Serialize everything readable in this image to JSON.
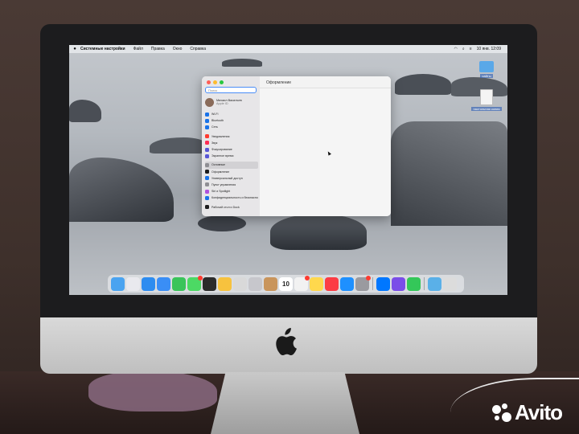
{
  "menubar": {
    "app_name": "Системные настройки",
    "items": [
      "Файл",
      "Правка",
      "Окно",
      "Справка"
    ],
    "clock": "10 янв. 12:09"
  },
  "desktop_icons": [
    {
      "label": "сайты",
      "icon": "folder-icon"
    },
    {
      "label": "настольная копия",
      "icon": "document-icon"
    }
  ],
  "settings": {
    "search_placeholder": "Поиск",
    "account": {
      "name": "Михаил Васильев",
      "subtitle": "Apple ID"
    },
    "sidebar": [
      {
        "label": "Wi-Fi",
        "color": "#1a73e8"
      },
      {
        "label": "Bluetooth",
        "color": "#1a73e8"
      },
      {
        "label": "Сеть",
        "color": "#1a73e8"
      },
      {
        "label": "Уведомления",
        "color": "#ff3b30",
        "gap": true
      },
      {
        "label": "Звук",
        "color": "#ff2d55"
      },
      {
        "label": "Фокусирование",
        "color": "#5856d6"
      },
      {
        "label": "Экранное время",
        "color": "#5856d6"
      },
      {
        "label": "Основные",
        "color": "#8e8e93",
        "gap": true,
        "selected": true
      },
      {
        "label": "Оформление",
        "color": "#1c1c1e"
      },
      {
        "label": "Универсальный доступ",
        "color": "#1a73e8"
      },
      {
        "label": "Пункт управления",
        "color": "#8e8e93"
      },
      {
        "label": "Siri и Spotlight",
        "color": "#af52de"
      },
      {
        "label": "Конфиденциальность и безопасность",
        "color": "#1a73e8"
      },
      {
        "label": "Рабочий стол и Dock",
        "color": "#1c1c1e",
        "gap": true
      }
    ],
    "content_title": "Оформление"
  },
  "dock": {
    "calendar_day": "10",
    "apps": [
      {
        "name": "finder-icon",
        "color": "#4aa3f0"
      },
      {
        "name": "launchpad-icon",
        "color": "#e9e9ee"
      },
      {
        "name": "safari-icon",
        "color": "#2d8cf0"
      },
      {
        "name": "mail-icon",
        "color": "#3a8ef6"
      },
      {
        "name": "facetime-icon",
        "color": "#3ac45a"
      },
      {
        "name": "messages-icon",
        "color": "#4cd964",
        "badge": true
      },
      {
        "name": "calculator-icon",
        "color": "#2b2b2b"
      },
      {
        "name": "photos-icon",
        "color": "#f7c23e"
      },
      {
        "name": "photo-booth-icon",
        "color": "#d9d9d9"
      },
      {
        "name": "finder2-icon",
        "color": "#c7c7cc"
      },
      {
        "name": "contacts-icon",
        "color": "#c9955c"
      },
      {
        "name": "calendar-icon",
        "color": "#ffffff",
        "calendar": true
      },
      {
        "name": "reminders-icon",
        "color": "#f2f2f2",
        "badge": true
      },
      {
        "name": "notes-icon",
        "color": "#ffd84d"
      },
      {
        "name": "music-icon",
        "color": "#fc3c44"
      },
      {
        "name": "app-store-icon",
        "color": "#1e90ff"
      },
      {
        "name": "system-settings-icon",
        "color": "#9a9a9f",
        "badge": true
      },
      {
        "name": "vk-icon",
        "color": "#0077ff",
        "sep_before": true
      },
      {
        "name": "shortcuts-icon",
        "color": "#7a4de8"
      },
      {
        "name": "numbers-icon",
        "color": "#34c759"
      },
      {
        "name": "downloads-icon",
        "color": "#5ab0e8",
        "sep_before": true
      },
      {
        "name": "trash-icon",
        "color": "#dcdcdc"
      }
    ]
  },
  "watermark": {
    "text": "Avito"
  }
}
